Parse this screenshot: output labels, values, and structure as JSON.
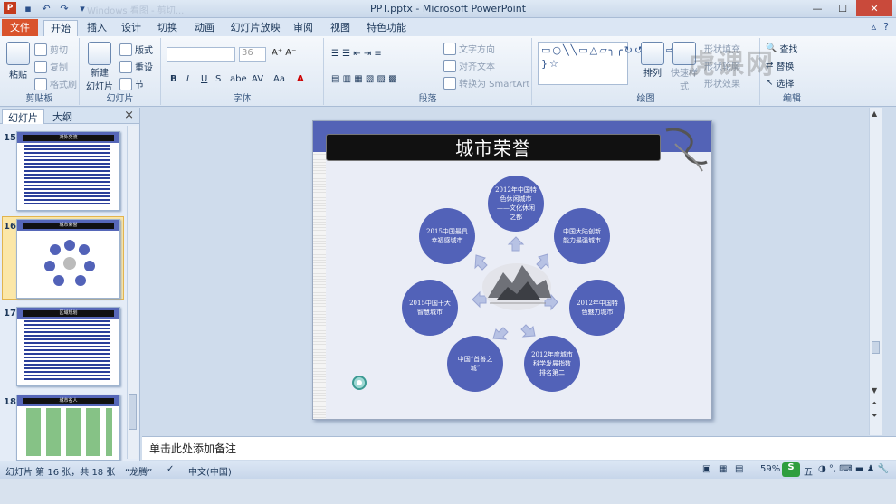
{
  "window": {
    "title": "PPT.pptx - Microsoft PowerPoint",
    "faint_tab": "Windows 看图 - 剪切...",
    "min": "—",
    "max": "☐",
    "close": "✕"
  },
  "tabs": {
    "file": "文件",
    "items": [
      "开始",
      "插入",
      "设计",
      "切换",
      "动画",
      "幻灯片放映",
      "审阅",
      "视图",
      "特色功能"
    ]
  },
  "ribbon": {
    "clipboard": {
      "paste": "粘贴",
      "cut": "剪切",
      "copy": "复制",
      "format": "格式刷",
      "label": "剪贴板"
    },
    "slides": {
      "new": "新建",
      "new2": "幻灯片",
      "layout": "版式",
      "reset": "重设",
      "section": "节",
      "label": "幻灯片"
    },
    "font": {
      "size": "36",
      "bold": "B",
      "italic": "I",
      "underline": "U",
      "strike": "S",
      "shadow": "abe",
      "spacing": "AV",
      "case": "Aa",
      "label": "字体"
    },
    "paragraph": {
      "direction": "文字方向",
      "align": "对齐文本",
      "smartart": "转换为 SmartArt",
      "label": "段落"
    },
    "drawing": {
      "arrange": "排列",
      "quickstyle": "快速样式",
      "fill": "形状填充",
      "outline": "形状轮廓",
      "effect": "形状效果",
      "label": "绘图"
    },
    "editing": {
      "find": "查找",
      "replace": "替换",
      "select": "选择",
      "label": "编辑"
    }
  },
  "watermark": "虎课网",
  "panel": {
    "tab_slides": "幻灯片",
    "tab_outline": "大纲",
    "close": "×",
    "thumbs": [
      {
        "num": "15",
        "title": "对外交流"
      },
      {
        "num": "16",
        "title": "城市荣誉"
      },
      {
        "num": "17",
        "title": "区域规划"
      },
      {
        "num": "18",
        "title": "城市名人"
      }
    ]
  },
  "slide": {
    "title": "城市荣誉",
    "circles": [
      "2012年中国特色休闲城市——文化休闲之都",
      "中国大陆创新能力最强城市",
      "2012年中国特色魅力城市",
      "2012年度城市科学发展指数排名第二",
      "中国“首善之城”",
      "2015中国十大智慧城市",
      "2015中国最具幸福感城市"
    ]
  },
  "notes": "单击此处添加备注",
  "status": {
    "slide": "幻灯片 第 16 张，共 18 张",
    "theme": "“龙腾”",
    "lang": "中文(中国)",
    "zoom": "59%",
    "ime": "五"
  }
}
